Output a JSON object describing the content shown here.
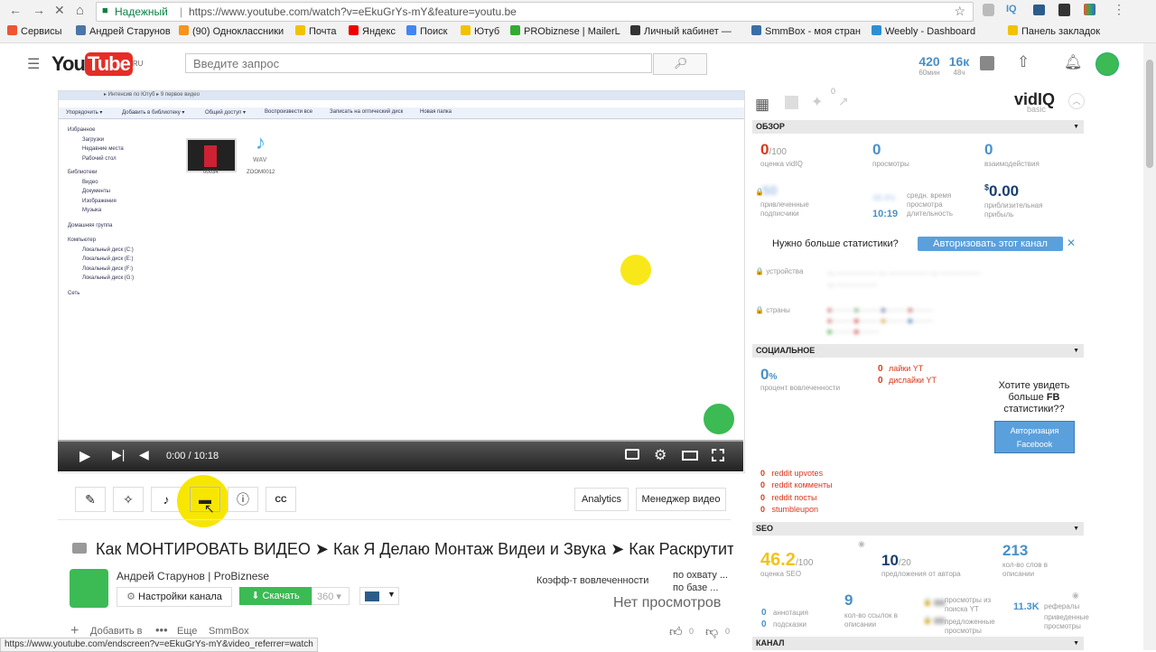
{
  "browser": {
    "secure_label": "Надежный",
    "url": "https://www.youtube.com/watch?v=eEkuGrYs-mY&feature=youtu.be",
    "bookmarks": [
      "Сервисы",
      "Андрей Старунов",
      "(90) Одноклассники",
      "Почта",
      "Яндекс",
      "Поиск",
      "Ютуб",
      "PRObiznese | MailerL",
      "Личный кабинет —",
      "SmmBox - моя стран",
      "Weebly - Dashboard",
      "Панель закладок"
    ],
    "status_url": "https://www.youtube.com/endscreen?v=eEkuGrYs-mY&video_referrer=watch"
  },
  "yt": {
    "logo": "You",
    "logo_tube": "Tube",
    "logo_region": "RU",
    "search_placeholder": "Введите запрос",
    "stat1_value": "420",
    "stat1_label": "60мин",
    "stat2_value": "16к",
    "stat2_label": "48ч"
  },
  "video": {
    "time": "0:00 / 10:18",
    "explorer_path": "▸ Интенсив по Ютуб ▸ 9 первое видео",
    "explorer_menu": [
      "Упорядочить ▾",
      "Добавить в библиотеку ▾",
      "Общий доступ ▾",
      "Воспроизвести все",
      "Записать на оптический диск",
      "Новая папка"
    ],
    "explorer_tree": [
      "Избранное",
      "Загрузки",
      "Недавние места",
      "Рабочий стол",
      "Библиотеки",
      "Видео",
      "Документы",
      "Изображения",
      "Музыка",
      "Домашняя группа",
      "Компьютер",
      "Локальный диск (C:)",
      "Локальный диск (E:)",
      "Локальный диск (F:)",
      "Локальный диск (G:)",
      "Сеть"
    ],
    "file1": "00034",
    "file2": "ZOOM0012",
    "wav": "WAV"
  },
  "toolbar": {
    "analytics": "Analytics",
    "manager": "Менеджер видео"
  },
  "title": "Как МОНТИРОВАТЬ ВИДЕО ➤ Как Я Делаю Монтаж Видеи и Звука ➤ Как Раскрутит",
  "channel": {
    "name": "Андрей Старунов | ProBiznese",
    "settings": "Настройки канала",
    "download": "Скачать",
    "quality": "360",
    "engagement": "Коэфф-т вовлеченности",
    "reach1": "по охвату ...",
    "reach2": "по базе ...",
    "no_views": "Нет просмотров",
    "add_to": "Добавить в",
    "more": "Еще",
    "smmbox": "SmmBox",
    "likes": "0",
    "dislikes": "0"
  },
  "vidiq": {
    "brand": "vidIQ",
    "plan": "basic",
    "twitter_count": "0",
    "sections": {
      "overview": "ОБЗОР",
      "social": "СОЦИАЛЬНОЕ",
      "seo": "SEO",
      "channel": "КАНАЛ"
    },
    "score": "0",
    "score_max": "/100",
    "score_label": "оценка vidIQ",
    "views": "0",
    "views_label": "просмотры",
    "interactions": "0",
    "interactions_label": "взаимодействия",
    "subs_label": "привлеченные подписчики",
    "avg_label": "средн. время просмотра длительность",
    "avg_value": "10:19",
    "income_prefix": "$",
    "income": "0.00",
    "income_label": "приблизительная прибыль",
    "need_more": "Нужно больше статистики?",
    "auth_channel": "Авторизовать этот канал",
    "devices": "устройства",
    "countries": "страны",
    "engage_pct": "0",
    "engage_pct_unit": "%",
    "engage_label": "процент вовлеченности",
    "likes_yt": "лайки YT",
    "dislikes_yt": "дислайки YT",
    "likes_val": "0",
    "dislikes_val": "0",
    "fb_prompt_1": "Хотите увидеть",
    "fb_prompt_2": "больше",
    "fb_prompt_fb": "FB",
    "fb_prompt_3": "статистики??",
    "fb_btn_1": "Авторизация",
    "fb_btn_2": "Facebook",
    "reddit": [
      "reddit upvotes",
      "reddit комменты",
      "reddit посты",
      "stumbleupon"
    ],
    "reddit_vals": [
      "0",
      "0",
      "0",
      "0"
    ],
    "seo_score": "46.2",
    "seo_score_max": "/100",
    "seo_label": "оценка SEO",
    "tags": "10",
    "tags_max": "/20",
    "tags_label": "предложения от автора",
    "words": "213",
    "words_label": "кол-во слов в описании",
    "annot": "0",
    "annot_label": "аннотация",
    "subtitles": "0",
    "subtitles_label": "подсказки",
    "links": "9",
    "links_label": "кол-во ссылок в описании",
    "search_label": "просмотры из поиска YT",
    "suggested_label": "предложенные просмотры",
    "refs": "11.3K",
    "refs_label": "рефералы",
    "refs_label2": "приведенные просмотры"
  },
  "colors": {
    "red": "#e52d27",
    "vidiq_blue": "#4a90c8",
    "green": "#3cba54",
    "yellow": "#f7e600"
  }
}
